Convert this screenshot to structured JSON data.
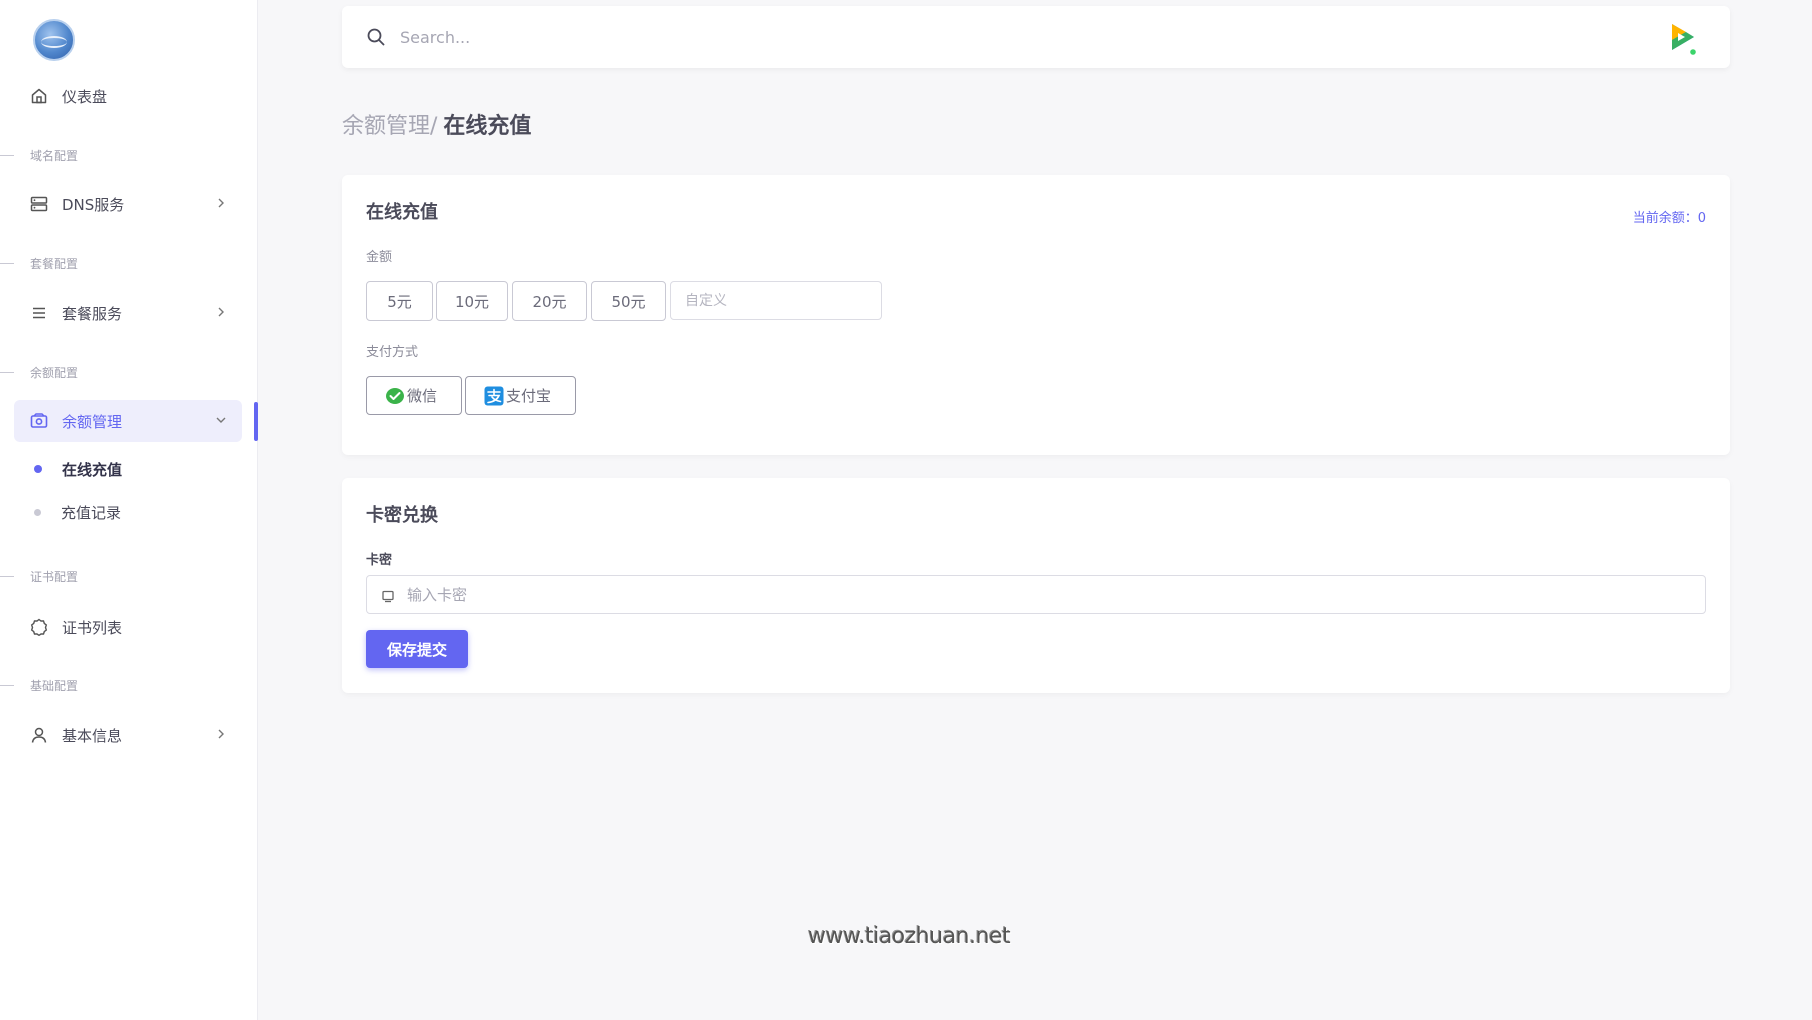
{
  "sidebar": {
    "dashboard": "仪表盘",
    "sections": {
      "domain": "域名配置",
      "package": "套餐配置",
      "balance": "余额配置",
      "cert": "证书配置",
      "basic": "基础配置"
    },
    "items": {
      "dns": "DNS服务",
      "package": "套餐服务",
      "balance_mgmt": "余额管理",
      "online_recharge": "在线充值",
      "recharge_records": "充值记录",
      "cert_list": "证书列表",
      "basic_info": "基本信息"
    }
  },
  "search": {
    "placeholder": "Search..."
  },
  "breadcrumb": {
    "parent": "余额管理/",
    "current": "在线充值"
  },
  "recharge_card": {
    "title": "在线充值",
    "balance_text": "当前余额：0",
    "amount_label": "金额",
    "amounts": [
      "5元",
      "10元",
      "20元",
      "50元"
    ],
    "custom_placeholder": "自定义",
    "payment_label": "支付方式",
    "payments": [
      "微信",
      "支付宝"
    ]
  },
  "redeem_card": {
    "title": "卡密兑换",
    "field_label": "卡密",
    "placeholder": "输入卡密",
    "submit_label": "保存提交"
  },
  "watermark": "www.tiaozhuan.net",
  "colors": {
    "accent": "#6366f1",
    "wechat": "#3bb34a",
    "alipay": "#1f8ee0"
  }
}
